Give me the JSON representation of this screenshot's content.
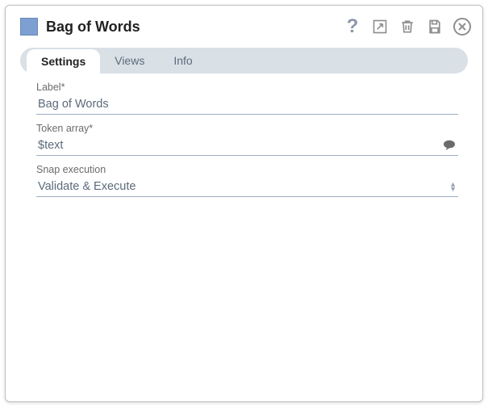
{
  "header": {
    "title": "Bag of Words",
    "swatch_color": "#7d9fd1"
  },
  "tabs": [
    {
      "label": "Settings",
      "active": true
    },
    {
      "label": "Views",
      "active": false
    },
    {
      "label": "Info",
      "active": false
    }
  ],
  "fields": {
    "label": {
      "caption": "Label*",
      "value": "Bag of Words"
    },
    "token_array": {
      "caption": "Token array*",
      "value": "$text"
    },
    "snap_execution": {
      "caption": "Snap execution",
      "value": "Validate & Execute"
    }
  },
  "icons": {
    "help": "?",
    "export": "export-icon",
    "delete": "trash-icon",
    "save": "save-icon",
    "close": "close-icon",
    "suggest": "speech-icon"
  }
}
